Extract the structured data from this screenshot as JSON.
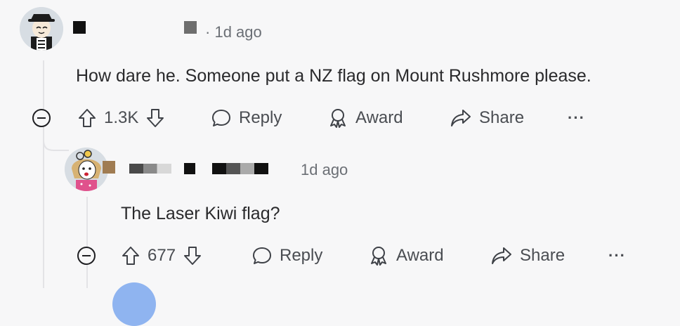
{
  "comment1": {
    "timestamp": "1d ago",
    "body": "How dare he. Someone put a NZ flag on Mount Rushmore please.",
    "upvote_count": "1.3K",
    "reply_label": "Reply",
    "award_label": "Award",
    "share_label": "Share",
    "more_label": "···"
  },
  "comment2": {
    "timestamp": "1d ago",
    "body": "The Laser Kiwi flag?",
    "upvote_count": "677",
    "reply_label": "Reply",
    "award_label": "Award",
    "share_label": "Share",
    "more_label": "···"
  },
  "colors": {
    "background": "#f7f7f8",
    "text": "#2a2a2c",
    "muted": "#6b6f75",
    "thread_line": "#e3e3e6"
  },
  "icons": [
    "upvote-arrow-icon",
    "downvote-arrow-icon",
    "reply-bubble-icon",
    "award-icon",
    "share-arrow-icon",
    "more-dots-icon",
    "collapse-icon"
  ]
}
